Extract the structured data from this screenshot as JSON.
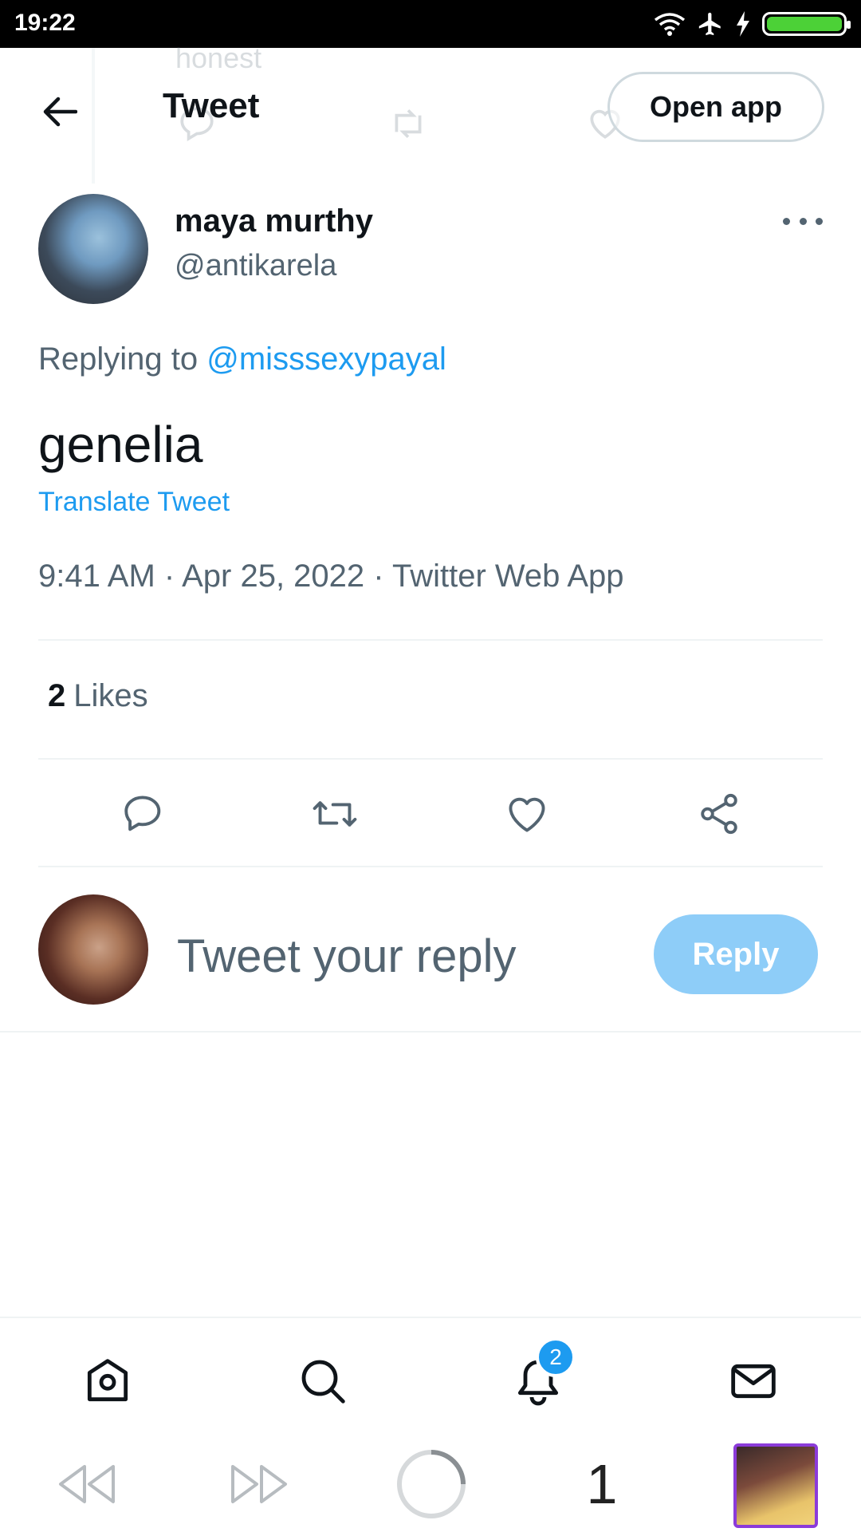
{
  "status_bar": {
    "time": "19:22"
  },
  "header": {
    "title": "Tweet",
    "open_app_label": "Open app",
    "ghost_text": "honest"
  },
  "tweet": {
    "author_name": "maya murthy",
    "author_handle": "@antikarela",
    "replying_prefix": "Replying to",
    "replying_mention": "@misssexypayal",
    "text": "genelia",
    "translate_label": "Translate Tweet",
    "meta": "9:41 AM · Apr 25, 2022 · Twitter Web App",
    "likes_count": "2",
    "likes_label": "Likes"
  },
  "composer": {
    "placeholder": "Tweet your reply",
    "reply_label": "Reply"
  },
  "bottom_nav": {
    "items": [
      "home-icon",
      "search-icon",
      "notifications-icon",
      "messages-icon"
    ],
    "notification_badge": "2"
  },
  "browser_bar": {
    "tab_count": "1"
  },
  "colors": {
    "accent": "#1d9bf0",
    "reply_button_disabled": "#8ecdf8",
    "secondary_text": "#536471",
    "primary_text": "#0f1419",
    "divider": "#eff3f4",
    "battery": "#4cd137"
  }
}
